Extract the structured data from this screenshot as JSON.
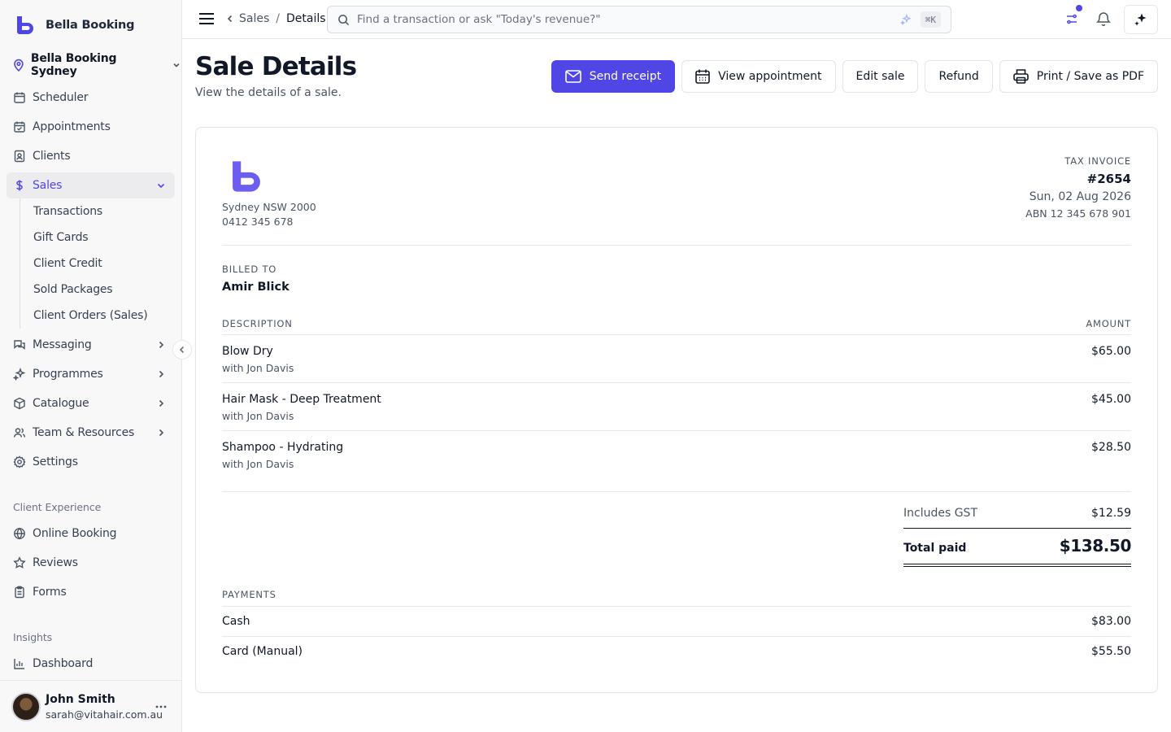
{
  "sidebar": {
    "brand_name": "Bella Booking",
    "location": "Bella Booking Sydney",
    "items": [
      {
        "label": "Scheduler",
        "icon": "calendar-icon"
      },
      {
        "label": "Appointments",
        "icon": "calendar-check-icon"
      },
      {
        "label": "Clients",
        "icon": "contact-card-icon"
      },
      {
        "label": "Sales",
        "icon": "dollar-icon",
        "active": true
      },
      {
        "label": "Messaging",
        "icon": "chat-icon"
      },
      {
        "label": "Programmes",
        "icon": "sparkles-icon"
      },
      {
        "label": "Catalogue",
        "icon": "box-icon"
      },
      {
        "label": "Team & Resources",
        "icon": "users-icon"
      },
      {
        "label": "Settings",
        "icon": "gear-icon"
      }
    ],
    "sales_sub": [
      "Transactions",
      "Gift Cards",
      "Client Credit",
      "Sold Packages",
      "Client Orders (Sales)"
    ],
    "client_experience_label": "Client Experience",
    "client_experience": [
      {
        "label": "Online Booking",
        "icon": "globe-icon"
      },
      {
        "label": "Reviews",
        "icon": "star-icon"
      },
      {
        "label": "Forms",
        "icon": "clipboard-icon"
      }
    ],
    "insights_label": "Insights",
    "insights": [
      {
        "label": "Dashboard",
        "icon": "bar-chart-icon"
      }
    ],
    "user": {
      "name": "John Smith",
      "email": "sarah@vitahair.com.au"
    }
  },
  "topbar": {
    "breadcrumb_parent": "Sales",
    "breadcrumb_sep": "/",
    "breadcrumb_current": "Details",
    "search_placeholder": "Find a transaction or ask \"Today's revenue?\"",
    "shortcut": "⌘K"
  },
  "page": {
    "title": "Sale Details",
    "subtitle": "View the details of a sale.",
    "actions": {
      "send_receipt": "Send receipt",
      "view_appointment": "View appointment",
      "edit_sale": "Edit sale",
      "refund": "Refund",
      "print": "Print / Save as PDF"
    }
  },
  "invoice": {
    "address_line1": "Sydney NSW 2000",
    "address_line2": "0412 345 678",
    "label": "TAX INVOICE",
    "number": "#2654",
    "date": "Sun, 02 Aug 2026",
    "abn": "ABN 12 345 678 901",
    "billed_to_label": "BILLED TO",
    "billed_to": "Amir Blick",
    "description_header": "DESCRIPTION",
    "amount_header": "AMOUNT",
    "lines": [
      {
        "desc": "Blow Dry",
        "staff": "with Jon Davis",
        "amount": "$65.00"
      },
      {
        "desc": "Hair Mask - Deep Treatment",
        "staff": "with Jon Davis",
        "amount": "$45.00"
      },
      {
        "desc": "Shampoo - Hydrating",
        "staff": "with Jon Davis",
        "amount": "$28.50"
      }
    ],
    "gst_label": "Includes GST",
    "gst_value": "$12.59",
    "total_label": "Total paid",
    "total_value": "$138.50",
    "payments_label": "PAYMENTS",
    "payments": [
      {
        "method": "Cash",
        "amount": "$83.00"
      },
      {
        "method": "Card (Manual)",
        "amount": "$55.50"
      }
    ]
  },
  "colors": {
    "accent": "#4f46e5",
    "text": "#111827",
    "muted": "#4b5563",
    "border": "#e5e7eb"
  }
}
